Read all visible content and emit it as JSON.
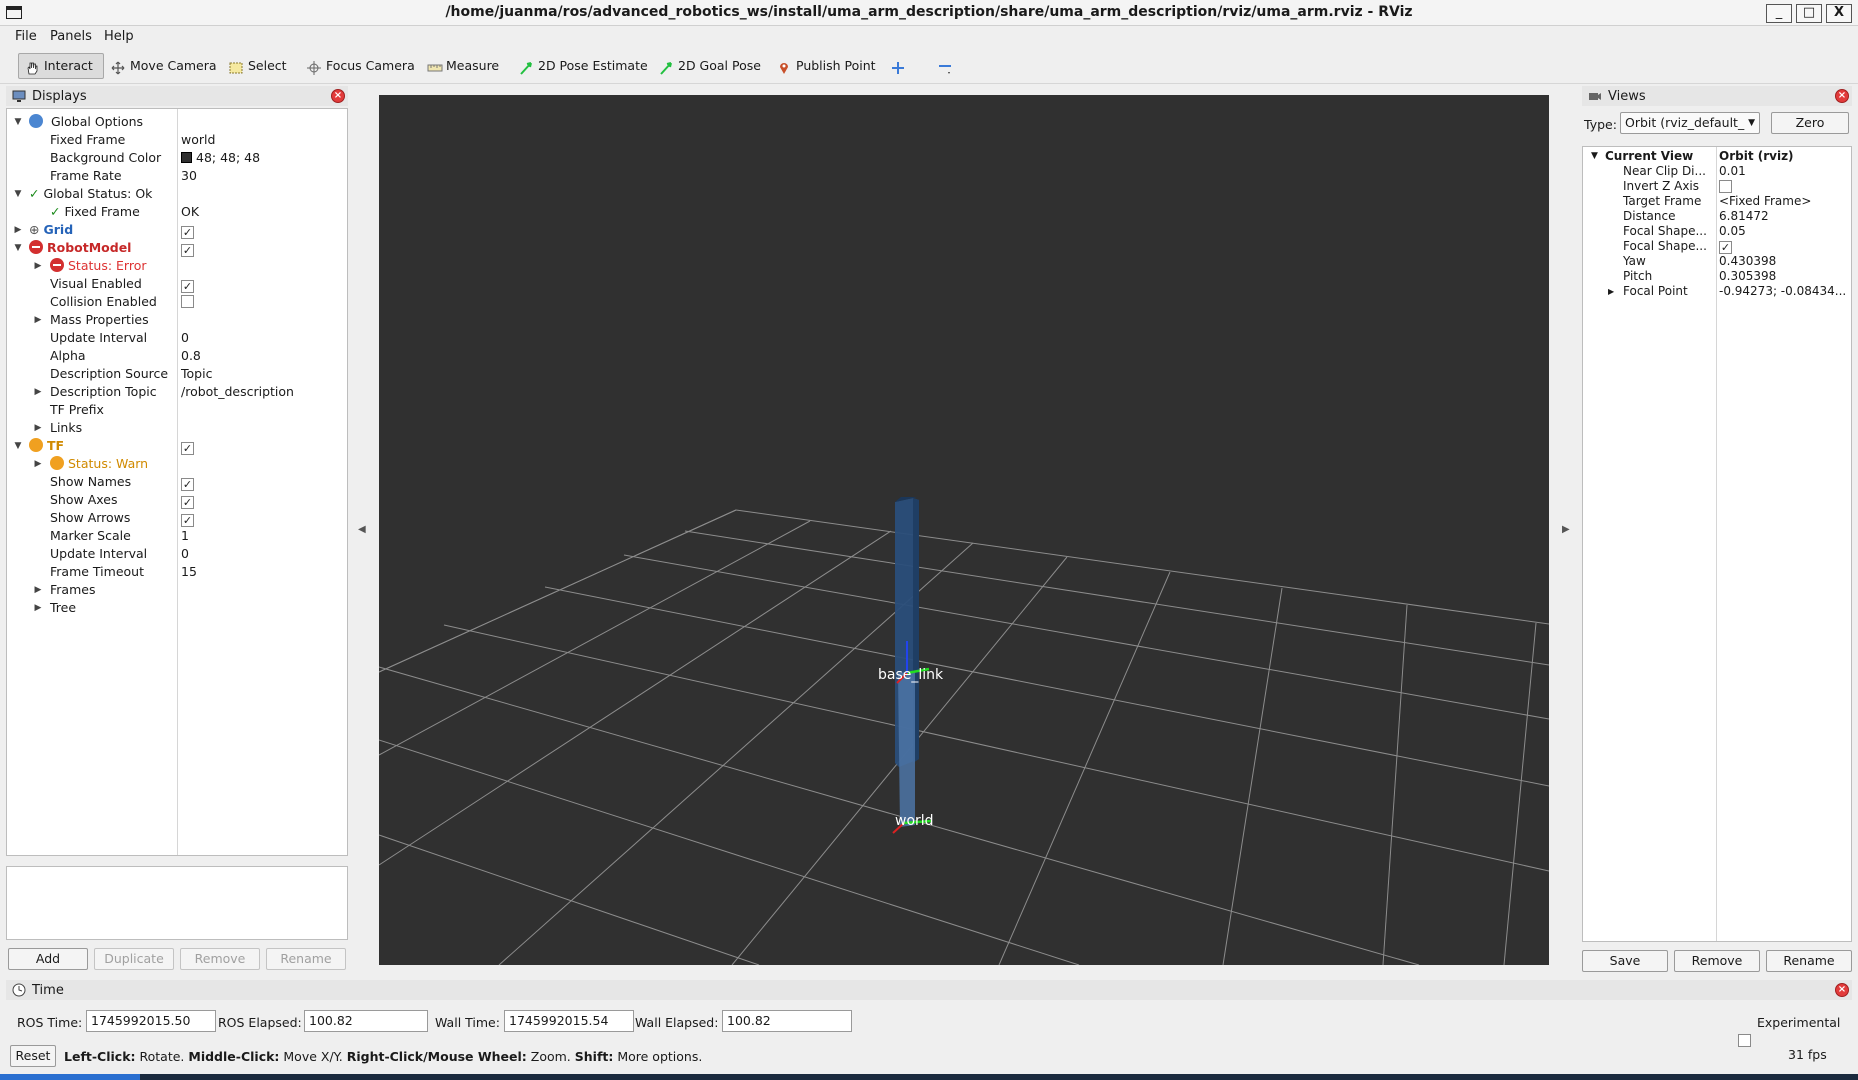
{
  "window": {
    "title": "/home/juanma/ros/advanced_robotics_ws/install/uma_arm_description/share/uma_arm_description/rviz/uma_arm.rviz - RViz",
    "buttons": {
      "minimize": "_",
      "maximize": "□",
      "close": "X"
    }
  },
  "menu": {
    "file": "File",
    "panels": "Panels",
    "help": "Help"
  },
  "toolbar": {
    "interact": "Interact",
    "move_camera": "Move Camera",
    "select": "Select",
    "focus_camera": "Focus Camera",
    "measure": "Measure",
    "pose_estimate": "2D Pose Estimate",
    "goal_pose": "2D Goal Pose",
    "publish_point": "Publish Point"
  },
  "displays": {
    "title": "Displays",
    "global_options": "Global Options",
    "fixed_frame_label": "Fixed Frame",
    "fixed_frame_value": "world",
    "background_color_label": "Background Color",
    "background_color_value": "48; 48; 48",
    "frame_rate_label": "Frame Rate",
    "frame_rate_value": "30",
    "global_status": "Global Status: Ok",
    "gs_fixed_frame_label": "Fixed Frame",
    "gs_fixed_frame_value": "OK",
    "grid": "Grid",
    "robot_model": "RobotModel",
    "rm_status": "Status: Error",
    "visual_enabled": "Visual Enabled",
    "collision_enabled": "Collision Enabled",
    "mass_properties": "Mass Properties",
    "update_interval_label": "Update Interval",
    "update_interval_value": "0",
    "alpha_label": "Alpha",
    "alpha_value": "0.8",
    "desc_source_label": "Description Source",
    "desc_source_value": "Topic",
    "desc_topic_label": "Description Topic",
    "desc_topic_value": "/robot_description",
    "tf_prefix": "TF Prefix",
    "links": "Links",
    "tf": "TF",
    "tf_status": "Status: Warn",
    "show_names": "Show Names",
    "show_axes": "Show Axes",
    "show_arrows": "Show Arrows",
    "marker_scale_label": "Marker Scale",
    "marker_scale_value": "1",
    "tf_update_interval_label": "Update Interval",
    "tf_update_interval_value": "0",
    "frame_timeout_label": "Frame Timeout",
    "frame_timeout_value": "15",
    "frames": "Frames",
    "tree": "Tree",
    "buttons": {
      "add": "Add",
      "duplicate": "Duplicate",
      "remove": "Remove",
      "rename": "Rename"
    },
    "checkbox_states": {
      "grid": true,
      "robot_model": true,
      "visual_enabled": true,
      "collision_enabled": false,
      "tf": true,
      "show_names": true,
      "show_axes": true,
      "show_arrows": true
    }
  },
  "viewport": {
    "background_color": "#303030",
    "frame_labels": {
      "base_link": "base_link",
      "world": "world"
    }
  },
  "views": {
    "title": "Views",
    "type_label": "Type:",
    "type_value": "Orbit (rviz_default_",
    "zero_button": "Zero",
    "current_view_label": "Current View",
    "current_view_value": "Orbit (rviz)",
    "near_clip_label": "Near Clip Di...",
    "near_clip_value": "0.01",
    "invert_z_label": "Invert Z Axis",
    "target_frame_label": "Target Frame",
    "target_frame_value": "<Fixed Frame>",
    "distance_label": "Distance",
    "distance_value": "6.81472",
    "focal_shape1_label": "Focal Shape...",
    "focal_shape1_value": "0.05",
    "focal_shape2_label": "Focal Shape...",
    "yaw_label": "Yaw",
    "yaw_value": "0.430398",
    "pitch_label": "Pitch",
    "pitch_value": "0.305398",
    "focal_point_label": "Focal Point",
    "focal_point_value": "-0.94273; -0.08434...",
    "checkbox_states": {
      "invert_z": false,
      "focal_shape_fixed": true
    },
    "buttons": {
      "save": "Save",
      "remove": "Remove",
      "rename": "Rename"
    }
  },
  "time": {
    "title": "Time",
    "ros_time_label": "ROS Time:",
    "ros_time_value": "1745992015.50",
    "ros_elapsed_label": "ROS Elapsed:",
    "ros_elapsed_value": "100.82",
    "wall_time_label": "Wall Time:",
    "wall_time_value": "1745992015.54",
    "wall_elapsed_label": "Wall Elapsed:",
    "wall_elapsed_value": "100.82",
    "experimental_label": "Experimental",
    "experimental_checked": false
  },
  "statusbar": {
    "reset": "Reset",
    "hint_left_click": "Left-Click:",
    "hint_rotate": " Rotate. ",
    "hint_middle_click": "Middle-Click:",
    "hint_move": " Move X/Y. ",
    "hint_right_click": "Right-Click/Mouse Wheel:",
    "hint_zoom": " Zoom. ",
    "hint_shift": "Shift:",
    "hint_more": " More options.",
    "fps": "31 fps"
  },
  "colors": {
    "error": "#c62828",
    "warn": "#d08a00",
    "ok": "#1a8a1a",
    "link": "#2563b8",
    "grid": "#8a8a8a",
    "robot_body": "#2a4e7a"
  }
}
